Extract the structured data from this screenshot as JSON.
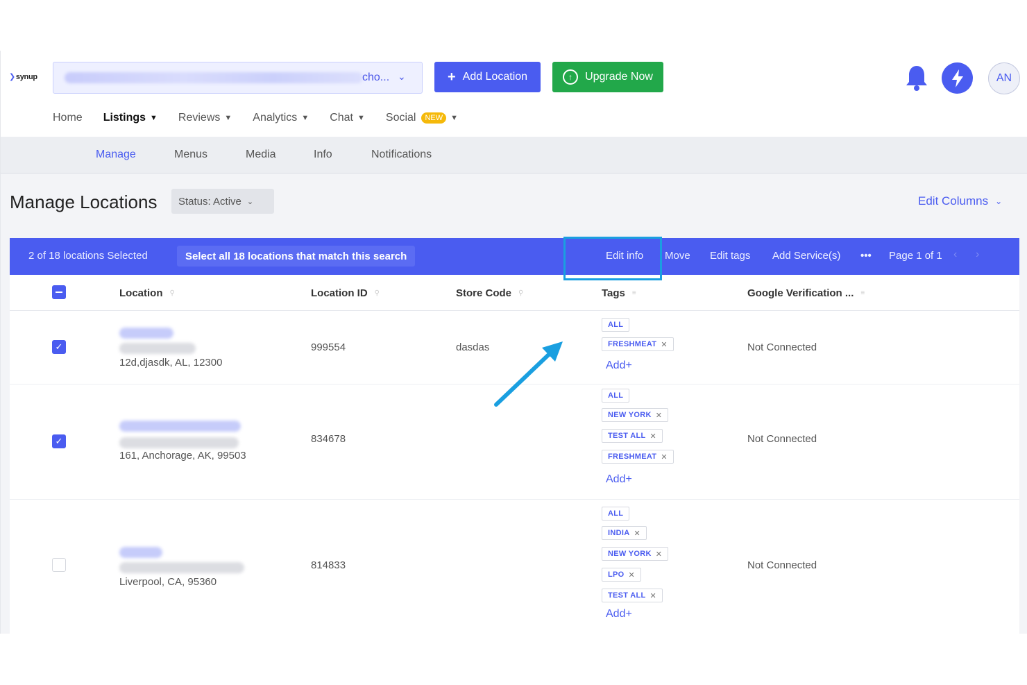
{
  "header": {
    "logo": "synup",
    "location_select": "cho...",
    "add_location": "Add Location",
    "upgrade": "Upgrade Now",
    "avatar": "AN"
  },
  "nav": [
    {
      "label": "Home",
      "dropdown": false
    },
    {
      "label": "Listings",
      "dropdown": true,
      "active": true
    },
    {
      "label": "Reviews",
      "dropdown": true
    },
    {
      "label": "Analytics",
      "dropdown": true
    },
    {
      "label": "Chat",
      "dropdown": true
    },
    {
      "label": "Social",
      "dropdown": true,
      "badge": "NEW"
    }
  ],
  "subnav": [
    "Manage",
    "Menus",
    "Media",
    "Info",
    "Notifications"
  ],
  "page": {
    "title": "Manage Locations",
    "status": "Status: Active",
    "edit_columns": "Edit Columns"
  },
  "selection": {
    "count": "2 of 18 locations Selected",
    "select_all": "Select all 18 locations that match this search",
    "actions": [
      "Edit info",
      "Move",
      "Edit tags",
      "Add Service(s)"
    ],
    "more": "•••",
    "page": "Page 1 of 1"
  },
  "table": {
    "columns": [
      "Location",
      "Location ID",
      "Store Code",
      "Tags",
      "Google Verification ..."
    ],
    "rows": [
      {
        "checked": true,
        "address": "12d,djasdk, AL, 12300",
        "id": "999554",
        "store_code": "dasdas",
        "tags": [
          "ALL",
          "FRESHMEAT"
        ],
        "add": "Add+",
        "google": "Not Connected"
      },
      {
        "checked": true,
        "address": "161, Anchorage, AK, 99503",
        "id": "834678",
        "store_code": "",
        "tags": [
          "ALL",
          "NEW YORK",
          "TEST ALL",
          "FRESHMEAT"
        ],
        "add": "Add+",
        "google": "Not Connected"
      },
      {
        "checked": false,
        "address": "Liverpool, CA, 95360",
        "id": "814833",
        "store_code": "",
        "tags": [
          "ALL",
          "INDIA",
          "NEW YORK",
          "LPO",
          "TEST ALL"
        ],
        "add": "Add+",
        "google": "Not Connected"
      }
    ]
  },
  "colors": {
    "primary": "#4a5cf0",
    "success": "#22a84a",
    "highlight": "#1a9fe0"
  }
}
